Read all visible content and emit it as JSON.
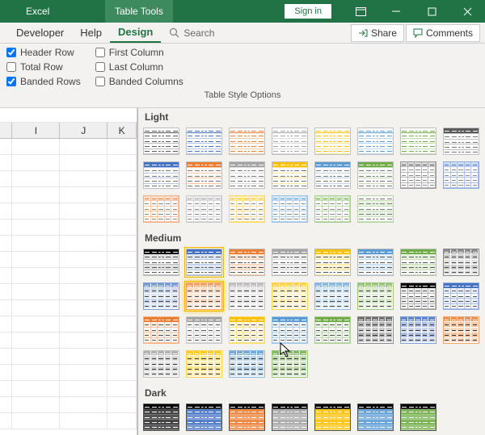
{
  "titlebar": {
    "app": "Excel",
    "contextual_tab": "Table Tools",
    "signin": "Sign in"
  },
  "ribbon": {
    "tabs": {
      "developer": "Developer",
      "help": "Help",
      "design": "Design"
    },
    "search_placeholder": "Search",
    "actions": {
      "share": "Share",
      "comments": "Comments"
    }
  },
  "style_options": {
    "header_row": "Header Row",
    "total_row": "Total Row",
    "banded_rows": "Banded Rows",
    "first_column": "First Column",
    "last_column": "Last Column",
    "banded_columns": "Banded Columns",
    "group_label": "Table Style Options",
    "checked": {
      "header_row": true,
      "banded_rows": true
    }
  },
  "columns": [
    "I",
    "J",
    "K"
  ],
  "gallery": {
    "sections": {
      "light": "Light",
      "medium": "Medium",
      "dark": "Dark"
    },
    "palette": [
      "#595959",
      "#4472c4",
      "#ed7d31",
      "#a5a5a5",
      "#ffc000",
      "#5b9bd5",
      "#70ad47"
    ],
    "selected_index": "medium-0-1",
    "hovered_index": "medium-1-2"
  }
}
